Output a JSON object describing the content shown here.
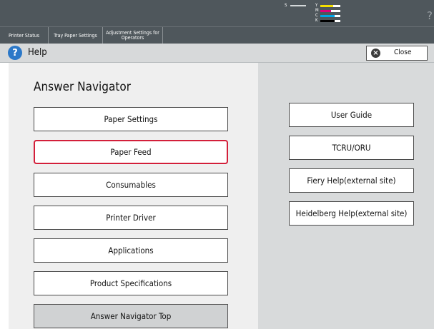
{
  "status": {
    "toner": [
      {
        "label": "S",
        "color": "#d4d8da",
        "level": 0.9
      },
      {
        "label": "Y",
        "color": "#f5e000",
        "level": 0.65
      },
      {
        "label": "M",
        "color": "#e0007a",
        "level": 0.55
      },
      {
        "label": "C",
        "color": "#00a6e8",
        "level": 0.7
      },
      {
        "label": "K",
        "color": "#000000",
        "level": 0.7
      }
    ],
    "help_icon": "?"
  },
  "tabs": [
    {
      "label": "Printer Status"
    },
    {
      "label": "Tray Paper Settings"
    },
    {
      "label": "Adjustment Settings for Operators"
    }
  ],
  "titlebar": {
    "icon": "question-circle-icon",
    "title": "Help",
    "close_label": "Close",
    "close_icon": "close-circle-icon"
  },
  "answer_navigator": {
    "heading": "Answer Navigator",
    "items": [
      {
        "label": "Paper Settings",
        "selected": false
      },
      {
        "label": "Paper Feed",
        "selected": true
      },
      {
        "label": "Consumables",
        "selected": false
      },
      {
        "label": "Printer Driver",
        "selected": false
      },
      {
        "label": "Applications",
        "selected": false
      },
      {
        "label": "Product Specifications",
        "selected": false
      }
    ],
    "top_label": "Answer Navigator Top"
  },
  "links": [
    {
      "label": "User Guide"
    },
    {
      "label": "TCRU/ORU"
    },
    {
      "label": "Fiery Help(external site)"
    },
    {
      "label": "Heidelberg Help(external site)"
    }
  ],
  "colors": {
    "accent_selected": "#d31f3a",
    "header_bg": "#4f575c",
    "help_icon_blue": "#2b78c8"
  }
}
